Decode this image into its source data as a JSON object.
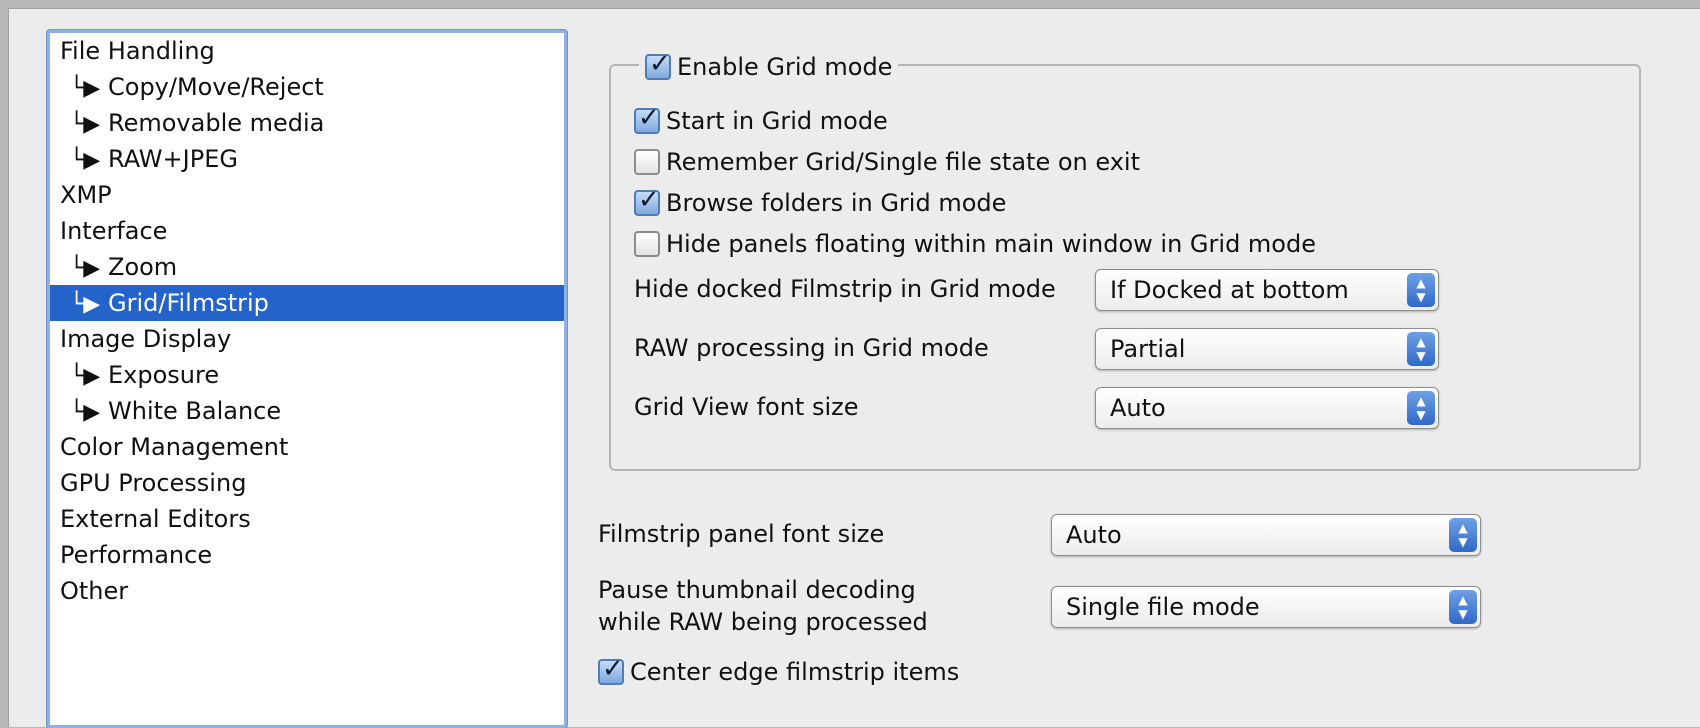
{
  "sidebar": {
    "items": [
      {
        "label": "File Handling",
        "child": false
      },
      {
        "label": "Copy/Move/Reject",
        "child": true
      },
      {
        "label": "Removable media",
        "child": true
      },
      {
        "label": "RAW+JPEG",
        "child": true
      },
      {
        "label": "XMP",
        "child": false
      },
      {
        "label": "Interface",
        "child": false
      },
      {
        "label": "Zoom",
        "child": true
      },
      {
        "label": "Grid/Filmstrip",
        "child": true,
        "selected": true
      },
      {
        "label": "Image Display",
        "child": false
      },
      {
        "label": "Exposure",
        "child": true
      },
      {
        "label": "White Balance",
        "child": true
      },
      {
        "label": "Color Management",
        "child": false
      },
      {
        "label": "GPU Processing",
        "child": false
      },
      {
        "label": "External Editors",
        "child": false
      },
      {
        "label": "Performance",
        "child": false
      },
      {
        "label": "Other",
        "child": false
      }
    ],
    "child_prefix": "└▶"
  },
  "grid_group": {
    "enable_label": "Enable Grid mode",
    "enable_checked": true,
    "options": [
      {
        "label": "Start in Grid mode",
        "checked": true
      },
      {
        "label": "Remember Grid/Single file state on exit",
        "checked": false
      },
      {
        "label": "Browse folders in Grid mode",
        "checked": true
      },
      {
        "label": "Hide panels floating within main window in Grid mode",
        "checked": false
      }
    ],
    "hide_filmstrip_label": "Hide docked Filmstrip in Grid mode",
    "hide_filmstrip_value": "If Docked at bottom",
    "raw_processing_label": "RAW processing in Grid mode",
    "raw_processing_value": "Partial",
    "font_size_label": "Grid View font size",
    "font_size_value": "Auto"
  },
  "filmstrip": {
    "font_size_label": "Filmstrip panel font size",
    "font_size_value": "Auto",
    "pause_label_line1": "Pause thumbnail decoding",
    "pause_label_line2": "while RAW being processed",
    "pause_value": "Single file mode",
    "center_label": "Center edge filmstrip items",
    "center_checked": true
  },
  "colors": {
    "selection": "#2463c9",
    "stepper_blue": "#3a74cf",
    "window_bg": "#ececec"
  }
}
